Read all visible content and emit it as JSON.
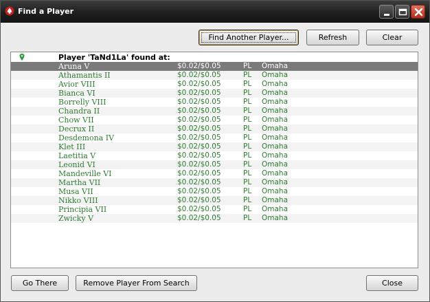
{
  "window": {
    "title": "Find a Player",
    "colors": {
      "titlebar": "#1f1f1f",
      "body": "#ececec",
      "row_text": "#2e7d32",
      "selected_row": "#7a7a7a"
    }
  },
  "toolbar": {
    "find_another_label": "Find Another Player...",
    "refresh_label": "Refresh",
    "clear_label": "Clear"
  },
  "results": {
    "header": "Player 'TaNd1La' found at:",
    "header_icon": "pin-icon",
    "selected_index": 0,
    "rows": [
      {
        "table": "Aruna V",
        "stakes": "$0.02/$0.05",
        "limit": "PL",
        "game": "Omaha"
      },
      {
        "table": "Athamantis II",
        "stakes": "$0.02/$0.05",
        "limit": "PL",
        "game": "Omaha"
      },
      {
        "table": "Avior VIII",
        "stakes": "$0.02/$0.05",
        "limit": "PL",
        "game": "Omaha"
      },
      {
        "table": "Bianca VI",
        "stakes": "$0.02/$0.05",
        "limit": "PL",
        "game": "Omaha"
      },
      {
        "table": "Borrelly VIII",
        "stakes": "$0.02/$0.05",
        "limit": "PL",
        "game": "Omaha"
      },
      {
        "table": "Chandra II",
        "stakes": "$0.02/$0.05",
        "limit": "PL",
        "game": "Omaha"
      },
      {
        "table": "Chow VII",
        "stakes": "$0.02/$0.05",
        "limit": "PL",
        "game": "Omaha"
      },
      {
        "table": "Decrux II",
        "stakes": "$0.02/$0.05",
        "limit": "PL",
        "game": "Omaha"
      },
      {
        "table": "Desdemona IV",
        "stakes": "$0.02/$0.05",
        "limit": "PL",
        "game": "Omaha"
      },
      {
        "table": "Klet III",
        "stakes": "$0.02/$0.05",
        "limit": "PL",
        "game": "Omaha"
      },
      {
        "table": "Laetitia V",
        "stakes": "$0.02/$0.05",
        "limit": "PL",
        "game": "Omaha"
      },
      {
        "table": "Leonid VI",
        "stakes": "$0.02/$0.05",
        "limit": "PL",
        "game": "Omaha"
      },
      {
        "table": "Mandeville VI",
        "stakes": "$0.02/$0.05",
        "limit": "PL",
        "game": "Omaha"
      },
      {
        "table": "Martha VII",
        "stakes": "$0.02/$0.05",
        "limit": "PL",
        "game": "Omaha"
      },
      {
        "table": "Musa VII",
        "stakes": "$0.02/$0.05",
        "limit": "PL",
        "game": "Omaha"
      },
      {
        "table": "Nikko VIII",
        "stakes": "$0.02/$0.05",
        "limit": "PL",
        "game": "Omaha"
      },
      {
        "table": "Principia VII",
        "stakes": "$0.02/$0.05",
        "limit": "PL",
        "game": "Omaha"
      },
      {
        "table": "Zwicky V",
        "stakes": "$0.02/$0.05",
        "limit": "PL",
        "game": "Omaha"
      }
    ]
  },
  "footer": {
    "go_there_label": "Go There",
    "remove_label": "Remove Player From Search",
    "close_label": "Close"
  }
}
